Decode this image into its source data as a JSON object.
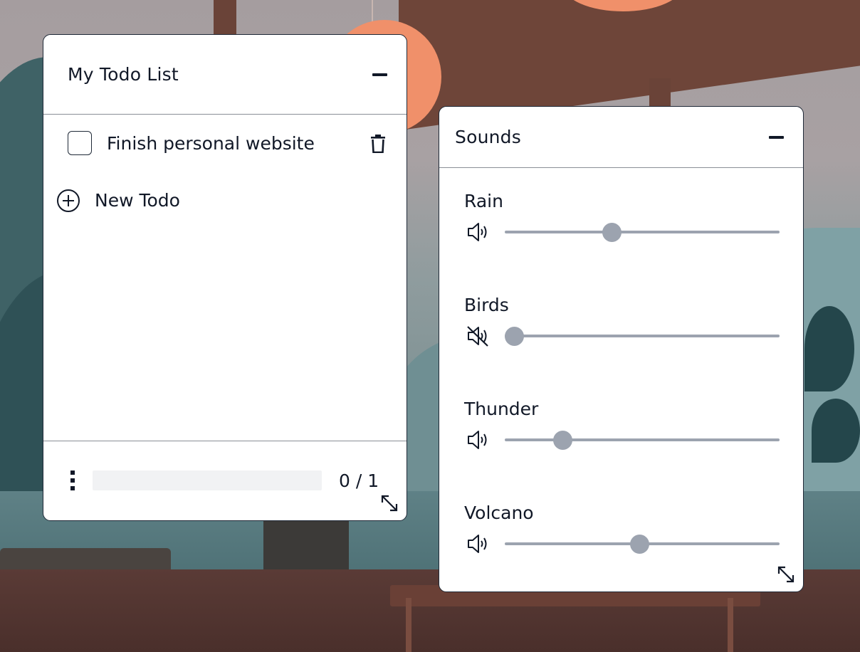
{
  "todo_window": {
    "title": "My Todo List",
    "items": [
      {
        "text": "Finish personal website",
        "checked": false
      }
    ],
    "new_todo_label": "New Todo",
    "progress": {
      "done": 0,
      "total": 1,
      "text": "0 / 1"
    }
  },
  "sounds_window": {
    "title": "Sounds",
    "sounds": [
      {
        "label": "Rain",
        "volume": 0.38,
        "muted": false
      },
      {
        "label": "Birds",
        "volume": 0.0,
        "muted": true
      },
      {
        "label": "Thunder",
        "volume": 0.19,
        "muted": false
      },
      {
        "label": "Volcano",
        "volume": 0.49,
        "muted": false
      }
    ]
  },
  "icons": {
    "minimize": "minimize-icon",
    "trash": "trash-icon",
    "add": "plus-circle-icon",
    "menu": "vertical-dots-icon",
    "resize": "resize-diagonal-icon",
    "volume_on": "speaker-on-icon",
    "volume_off": "speaker-muted-icon"
  },
  "colors": {
    "window_bg": "#ffffff",
    "border": "#1f2937",
    "slider": "#9ca3af",
    "progress_track": "#f1f2f4"
  }
}
